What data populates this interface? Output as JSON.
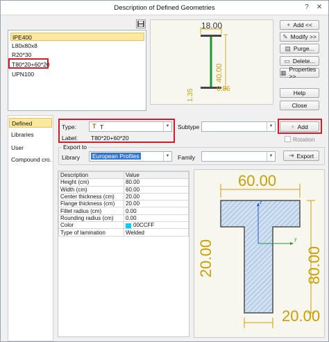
{
  "window": {
    "title": "Description of Defined Geometries",
    "help_glyph": "?",
    "close_glyph": "✕"
  },
  "geometry_list": {
    "items": [
      "IPE400",
      "L80x80x8",
      "R20*30",
      "T80*20+60*20",
      "UPN100"
    ],
    "selected_index": 0,
    "highlighted_index": 3
  },
  "preview_top": {
    "dim_width": "18.00",
    "dim_height": "40.00",
    "dim_web": "0.86",
    "dim_flange": "1.35"
  },
  "side_buttons": {
    "add": "Add <<",
    "modify": "Modify >>",
    "purge": "Purge...",
    "delete": "Delete...",
    "properties": "Properties >>",
    "help": "Help",
    "close": "Close"
  },
  "nav": {
    "items": [
      "Defined",
      "Libraries",
      "User",
      "Compound cro..."
    ],
    "selected_index": 0
  },
  "form": {
    "type_label": "Type:",
    "type_value": "T",
    "label_label": "Label:",
    "label_value": "T80*20+60*20",
    "subtype_label": "Subtype :",
    "subtype_value": "",
    "add_label": "Add",
    "rotation_label": "Rotation",
    "export_group": "Export to",
    "library_label": "Library",
    "library_value": "European Profiles",
    "family_label": "Family",
    "family_value": "",
    "export_label": "Export"
  },
  "props": {
    "headers": [
      "Description",
      "Value"
    ],
    "rows": [
      [
        "Height (cm)",
        "80.00"
      ],
      [
        "Width (cm)",
        "60.00"
      ],
      [
        "Center thickness (cm)",
        "20.00"
      ],
      [
        "Flange thickness (cm)",
        "20.00"
      ],
      [
        "Fillet radius (cm)",
        "0.00"
      ],
      [
        "Rounding radius (cm)",
        "0.00"
      ],
      [
        "Color",
        "00CCFF"
      ],
      [
        "Type of lamination",
        "Welded"
      ]
    ],
    "color_swatch": "#00ccff"
  },
  "preview_bottom": {
    "dim_width": "60.00",
    "dim_height": "80.00",
    "dim_web_thickness": "20.00",
    "dim_flange_thickness": "20.00",
    "axis_z": "z",
    "axis_y": "y"
  },
  "colors": {
    "dimension": "#c8a000",
    "highlight_red": "#d01b2a",
    "selection": "#fde8a0"
  }
}
